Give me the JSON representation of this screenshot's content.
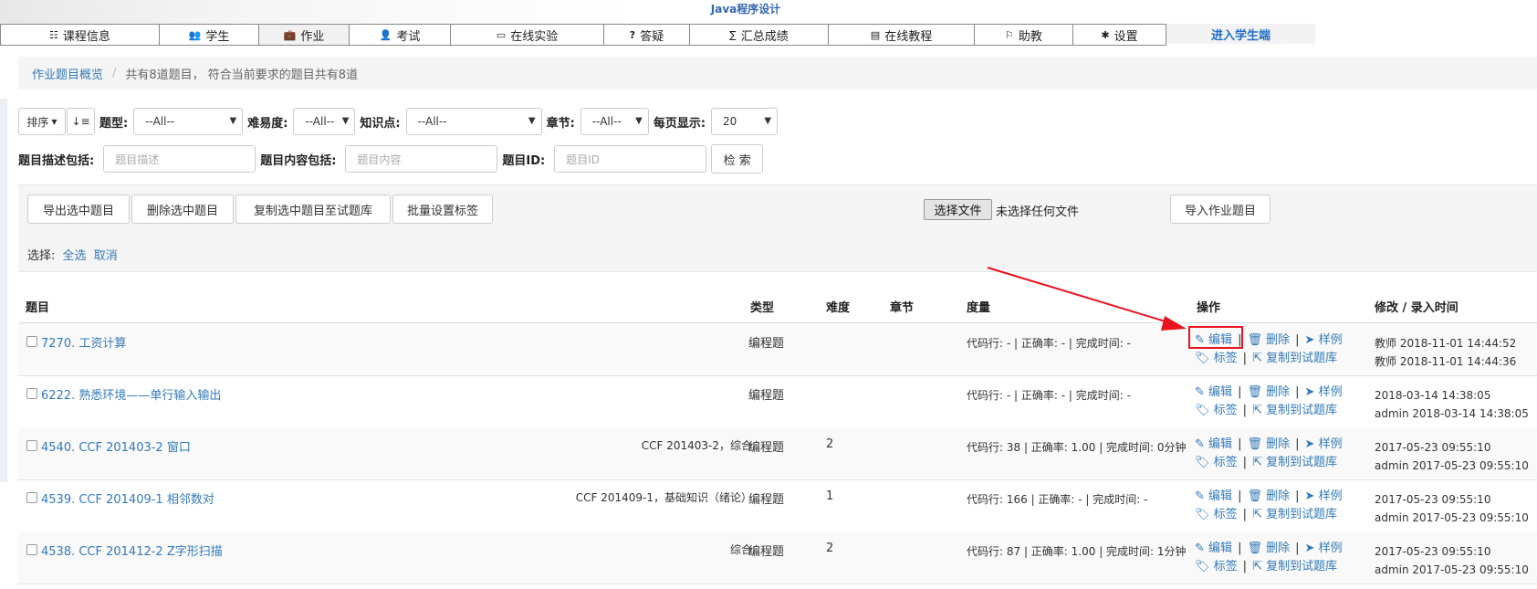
{
  "course_title": "Java程序设计",
  "nav": [
    {
      "label": "课程信息",
      "icon": "☷"
    },
    {
      "label": "学生",
      "icon": "👥"
    },
    {
      "label": "作业",
      "icon": "💼"
    },
    {
      "label": "考试",
      "icon": "👤"
    },
    {
      "label": "在线实验",
      "icon": "▭"
    },
    {
      "label": "答疑",
      "icon": "?"
    },
    {
      "label": "汇总成绩",
      "icon": "∑"
    },
    {
      "label": "在线教程",
      "icon": "▤"
    },
    {
      "label": "助教",
      "icon": "⚐"
    },
    {
      "label": "设置",
      "icon": "✱"
    },
    {
      "label": "进入学生端",
      "icon": ""
    }
  ],
  "breadcrumb": {
    "link": "作业题目概览",
    "summary": "共有8道题目， 符合当前要求的题目共有8道"
  },
  "filters": {
    "sort_label": "排序",
    "type_label": "题型:",
    "type_value": "--All--",
    "difficulty_label": "难易度:",
    "difficulty_value": "--All--",
    "knowledge_label": "知识点:",
    "knowledge_value": "--All--",
    "chapter_label": "章节:",
    "chapter_value": "--All--",
    "perpage_label": "每页显示:",
    "perpage_value": "20"
  },
  "search": {
    "desc_label": "题目描述包括:",
    "desc_placeholder": "题目描述",
    "content_label": "题目内容包括:",
    "content_placeholder": "题目内容",
    "id_label": "题目ID:",
    "id_placeholder": "题目ID",
    "button": "检 索"
  },
  "toolbar": {
    "export": "导出选中题目",
    "delete": "删除选中题目",
    "copy": "复制选中题目至试题库",
    "tag": "批量设置标签",
    "file_button": "选择文件",
    "file_status": "未选择任何文件",
    "import": "导入作业题目",
    "select_label": "选择:",
    "select_all": "全选",
    "cancel": "取消"
  },
  "table": {
    "headers": {
      "title": "题目",
      "type": "类型",
      "difficulty": "难度",
      "chapter": "章节",
      "metric": "度量",
      "ops": "操作",
      "time": "修改 / 录入时间"
    },
    "op_labels": {
      "edit": "编辑",
      "delete": "删除",
      "sample": "样例",
      "tag": "标签",
      "copy": "复制到试题库"
    },
    "rows": [
      {
        "title": "7270. 工资计算",
        "tags": "",
        "type": "编程题",
        "difficulty": "",
        "metric": "代码行: - | 正确率: - | 完成时间: -",
        "time1": "教师 2018-11-01 14:44:52",
        "time2": "教师 2018-11-01 14:44:36"
      },
      {
        "title": "6222. 熟悉环境——单行输入输出",
        "tags": "",
        "type": "编程题",
        "difficulty": "",
        "metric": "代码行: - | 正确率: - | 完成时间: -",
        "time1": "2018-03-14 14:38:05",
        "time2": "admin 2018-03-14 14:38:05"
      },
      {
        "title": "4540. CCF 201403-2 窗口",
        "tags": "CCF 201403-2，综合",
        "type": "编程题",
        "difficulty": "2",
        "metric": "代码行: 38 | 正确率: 1.00 | 完成时间: 0分钟",
        "time1": "2017-05-23 09:55:10",
        "time2": "admin 2017-05-23 09:55:10"
      },
      {
        "title": "4539. CCF 201409-1 相邻数对",
        "tags": "CCF 201409-1，基础知识（绪论）",
        "type": "编程题",
        "difficulty": "1",
        "metric": "代码行: 166 | 正确率: - | 完成时间: -",
        "time1": "2017-05-23 09:55:10",
        "time2": "admin 2017-05-23 09:55:10"
      },
      {
        "title": "4538. CCF 201412-2 Z字形扫描",
        "tags": "综合",
        "type": "编程题",
        "difficulty": "2",
        "metric": "代码行: 87 | 正确率: 1.00 | 完成时间: 1分钟",
        "time1": "2017-05-23 09:55:10",
        "time2": "admin 2017-05-23 09:55:10"
      }
    ]
  },
  "colors": {
    "link": "#337ab7",
    "highlight": "#e8141e",
    "student_link": "#1e6ec8"
  }
}
